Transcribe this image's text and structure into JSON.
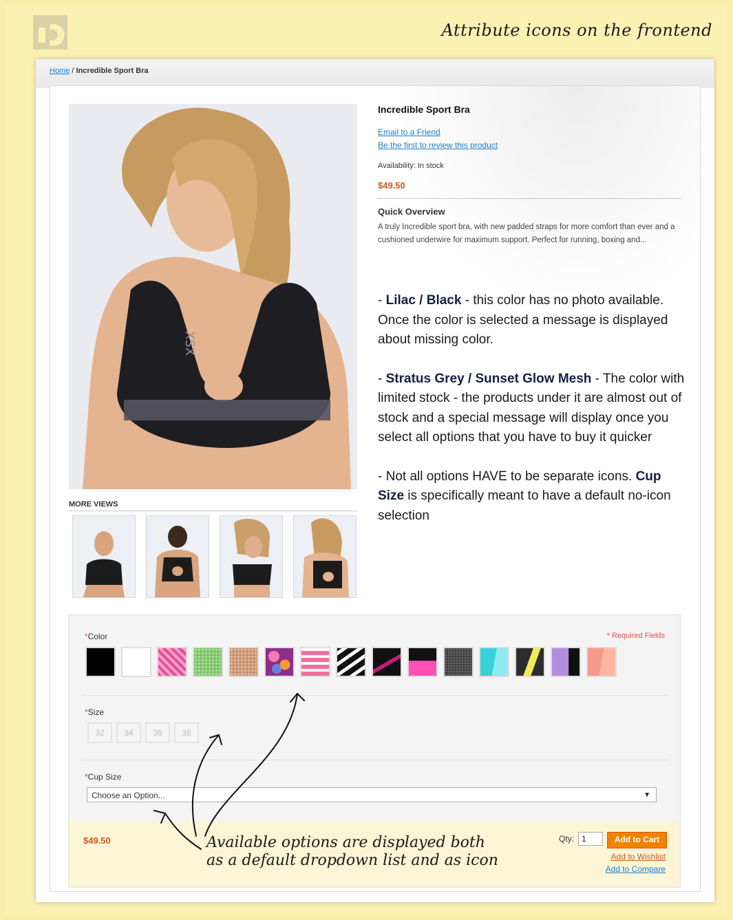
{
  "header": {
    "title": "Attribute icons on the frontend"
  },
  "breadcrumb": {
    "home": "Home",
    "separator": " / ",
    "current": "Incredible Sport Bra"
  },
  "product": {
    "name": "Incredible Sport Bra",
    "email_link": "Email to a Friend",
    "review_link": "Be the first to review this product",
    "availability": "Availability: In stock",
    "price": "$49.50",
    "overview_title": "Quick Overview",
    "overview_text": "A truly Incredible sport bra, with new padded straps for more comfort than ever and a cushioned underwire for maximum support. Perfect for running, boxing and..."
  },
  "more_views": {
    "title": "MORE VIEWS"
  },
  "notes": {
    "n1_dash": "- ",
    "n1_bold": "Lilac / Black",
    "n1_text": " - this color has no photo available. Once the color is selected a message is displayed about missing color.",
    "n2_dash": "- ",
    "n2_bold": "Stratus Grey / Sunset Glow Mesh",
    "n2_text": " - The color with limited stock - the products under it are almost out of stock and a special message will display once you select all options that you have to buy it quicker",
    "n3_text": "- Not all options HAVE to be separate icons. ",
    "n3_bold": "Cup Size",
    "n3_text2": " is specifically meant to have a default no-icon selection"
  },
  "options": {
    "required_fields": "* Required Fields",
    "color_label": "Color",
    "size_label": "Size",
    "cup_label": "Cup Size",
    "asterisk": "*",
    "sizes": [
      "32",
      "34",
      "36",
      "38"
    ],
    "cup_placeholder": "Choose an Option...",
    "colors": [
      "#000000",
      "#ffffff",
      "#e0509a",
      "#8fd07c",
      "#d6a48a",
      "#c85aa0",
      "#f06e9c",
      "#1a1a1a",
      "#1a1a1a",
      "#ff4fb5",
      "#444444",
      "#39d1d8",
      "#2d2d2d",
      "#b38ee0",
      "#f59a8a"
    ]
  },
  "cart": {
    "price": "$49.50",
    "qty_label": "Qty:",
    "qty_value": "1",
    "add_to_cart": "Add to Cart",
    "wishlist": "Add to Wishlist",
    "compare": "Add to Compare"
  },
  "annotation": {
    "line1": "Available options are displayed both",
    "line2": "as a default dropdown list and as icon"
  }
}
